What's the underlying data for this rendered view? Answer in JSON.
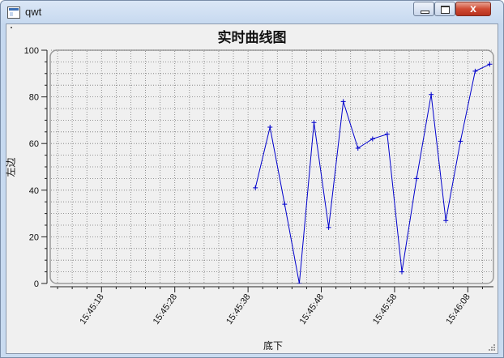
{
  "window": {
    "title": "qwt",
    "close_glyph": "x",
    "icons": [
      "app-icon",
      "minimize-icon",
      "maximize-icon",
      "close-icon"
    ]
  },
  "chart_data": {
    "type": "line",
    "title": "实时曲线图",
    "xlabel": "底下",
    "ylabel": "左边",
    "ylim": [
      0,
      100
    ],
    "y_ticks": [
      "0",
      "20",
      "40",
      "60",
      "80",
      "100"
    ],
    "x_ticks": [
      "15:45:18",
      "15:45:28",
      "15:45:38",
      "15:45:48",
      "15:45:58",
      "15:46:08"
    ],
    "x_tick_seconds": [
      18,
      28,
      38,
      48,
      58,
      68
    ],
    "xlim_seconds": [
      11,
      71.5
    ],
    "grid": true,
    "marker": "+",
    "line_color": "#0000cc",
    "series": [
      {
        "x_seconds": [
          39,
          41,
          43,
          45,
          47,
          49,
          51,
          53,
          55,
          57,
          59,
          61,
          63,
          65,
          67,
          69,
          71
        ],
        "values": [
          41,
          67,
          34,
          0,
          69,
          24,
          78,
          58,
          62,
          64,
          5,
          45,
          81,
          27,
          61,
          91,
          94
        ]
      }
    ]
  }
}
